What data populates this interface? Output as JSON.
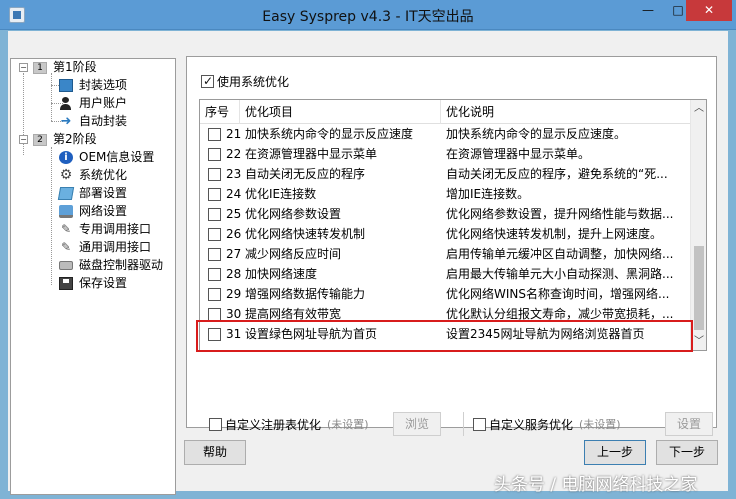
{
  "window": {
    "title": "Easy Sysprep v4.3 - IT天空出品",
    "minimize": "—",
    "maximize": "□",
    "close": "✕"
  },
  "tree": {
    "stage1": {
      "num": "1",
      "label": "第1阶段"
    },
    "stage1_items": [
      "封装选项",
      "用户账户",
      "自动封装"
    ],
    "stage2": {
      "num": "2",
      "label": "第2阶段"
    },
    "stage2_items": [
      "OEM信息设置",
      "系统优化",
      "部署设置",
      "网络设置",
      "专用调用接口",
      "通用调用接口",
      "磁盘控制器驱动",
      "保存设置"
    ]
  },
  "optimize": {
    "enable_label": "使用系统优化",
    "enabled": true
  },
  "list": {
    "headers": [
      "序号",
      "优化项目",
      "优化说明"
    ],
    "rows": [
      {
        "num": "21",
        "item": "加快系统内命令的显示反应速度",
        "desc": "加快系统内命令的显示反应速度。"
      },
      {
        "num": "22",
        "item": "在资源管理器中显示菜单",
        "desc": "在资源管理器中显示菜单。"
      },
      {
        "num": "23",
        "item": "自动关闭无反应的程序",
        "desc": "自动关闭无反应的程序，避免系统的“死..."
      },
      {
        "num": "24",
        "item": "优化IE连接数",
        "desc": "增加IE连接数。"
      },
      {
        "num": "25",
        "item": "优化网络参数设置",
        "desc": "优化网络参数设置，提升网络性能与数据..."
      },
      {
        "num": "26",
        "item": "优化网络快速转发机制",
        "desc": "优化网络快速转发机制，提升上网速度。"
      },
      {
        "num": "27",
        "item": "减少网络反应时间",
        "desc": "启用传输单元缓冲区自动调整，加快网络..."
      },
      {
        "num": "28",
        "item": "加快网络速度",
        "desc": "启用最大传输单元大小自动探测、黑洞路..."
      },
      {
        "num": "29",
        "item": "增强网络数据传输能力",
        "desc": "优化网络WINS名称查询时间，增强网络..."
      },
      {
        "num": "30",
        "item": "提高网络有效带宽",
        "desc": "优化默认分组报文寿命，减少带宽损耗，..."
      },
      {
        "num": "31",
        "item": "设置绿色网址导航为首页",
        "desc": "设置2345网址导航为网络浏览器首页"
      }
    ]
  },
  "custom": {
    "registry": {
      "label": "自定义注册表优化",
      "note": "(未设置)",
      "button": "浏览"
    },
    "service": {
      "label": "自定义服务优化",
      "note": "(未设置)",
      "button": "设置"
    }
  },
  "buttons": {
    "help": "帮助",
    "prev": "上一步",
    "next": "下一步"
  },
  "watermark": "头条号 / 电脑网络科技之家"
}
